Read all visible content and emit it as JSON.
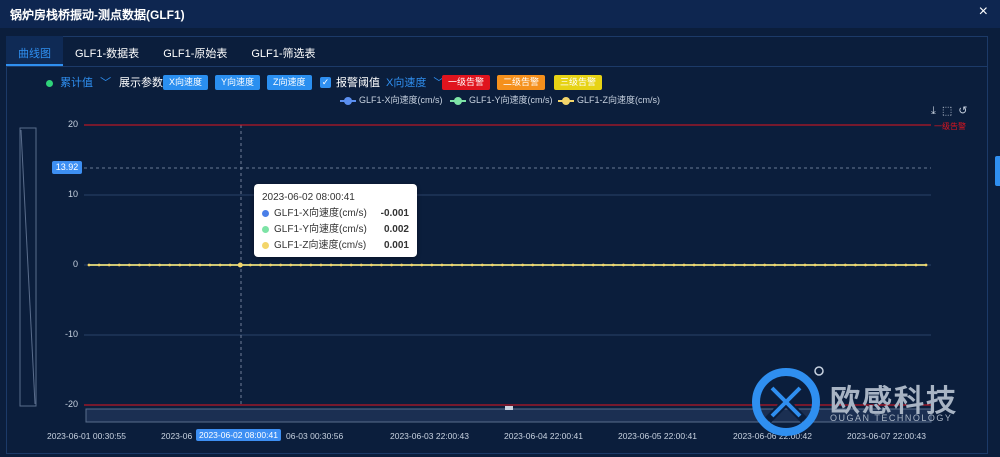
{
  "window": {
    "title": "锅炉房栈桥振动-测点数据(GLF1)",
    "close_glyph": "×"
  },
  "tabs": [
    {
      "label": "曲线图",
      "active": true
    },
    {
      "label": "GLF1-数据表",
      "active": false
    },
    {
      "label": "GLF1-原始表",
      "active": false
    },
    {
      "label": "GLF1-筛选表",
      "active": false
    }
  ],
  "toolbar": {
    "mode_select": "累计值",
    "param_label": "展示参数:",
    "param_chips": [
      "X向速度",
      "Y向速度",
      "Z向速度"
    ],
    "alarm_checkbox_label": "报警阈值",
    "alarm_param_select": "X向速度",
    "alarm_levels": [
      "一级告警",
      "二级告警",
      "三级告警"
    ]
  },
  "colors": {
    "accent": "#2f8ff0",
    "series_x": "#5b8ff0",
    "series_y": "#7de3a6",
    "series_z": "#f3d56a",
    "alarm_red": "#e0141e"
  },
  "icons": [
    "download-icon",
    "zoom-select-icon",
    "reset-icon"
  ],
  "chart_data": {
    "type": "line",
    "ylim": [
      -20,
      20
    ],
    "yticks": [
      "20",
      "10",
      "0",
      "-10",
      "-20"
    ],
    "x_ticks": [
      "2023-06-01 00:30:55",
      "2023-06-02 08:00:41",
      "2023-06-03 00:30:56",
      "2023-06-03 22:00:43",
      "2023-06-04 22:00:41",
      "2023-06-05 22:00:41",
      "2023-06-06 22:00:42",
      "2023-06-07 22:00:43"
    ],
    "x_tick_partial": "2023-06",
    "highlighted_x": "2023-06-02 08:00:41",
    "highlighted_y": "13.92",
    "alarm_line": {
      "label": "一级告警",
      "value": 20
    },
    "series": [
      {
        "name": "GLF1-X向速度(cm/s)",
        "values": [
          0
        ]
      },
      {
        "name": "GLF1-Y向速度(cm/s)",
        "values": [
          0
        ]
      },
      {
        "name": "GLF1-Z向速度(cm/s)",
        "values": [
          0
        ]
      }
    ],
    "tooltip": {
      "time": "2023-06-02 08:00:41",
      "rows": [
        {
          "name": "GLF1-X向速度(cm/s)",
          "value": "-0.001"
        },
        {
          "name": "GLF1-Y向速度(cm/s)",
          "value": "0.002"
        },
        {
          "name": "GLF1-Z向速度(cm/s)",
          "value": "0.001"
        }
      ]
    }
  },
  "logo": {
    "name": "欧感科技",
    "subtitle": "OUGAN TECHNOLOGY"
  }
}
